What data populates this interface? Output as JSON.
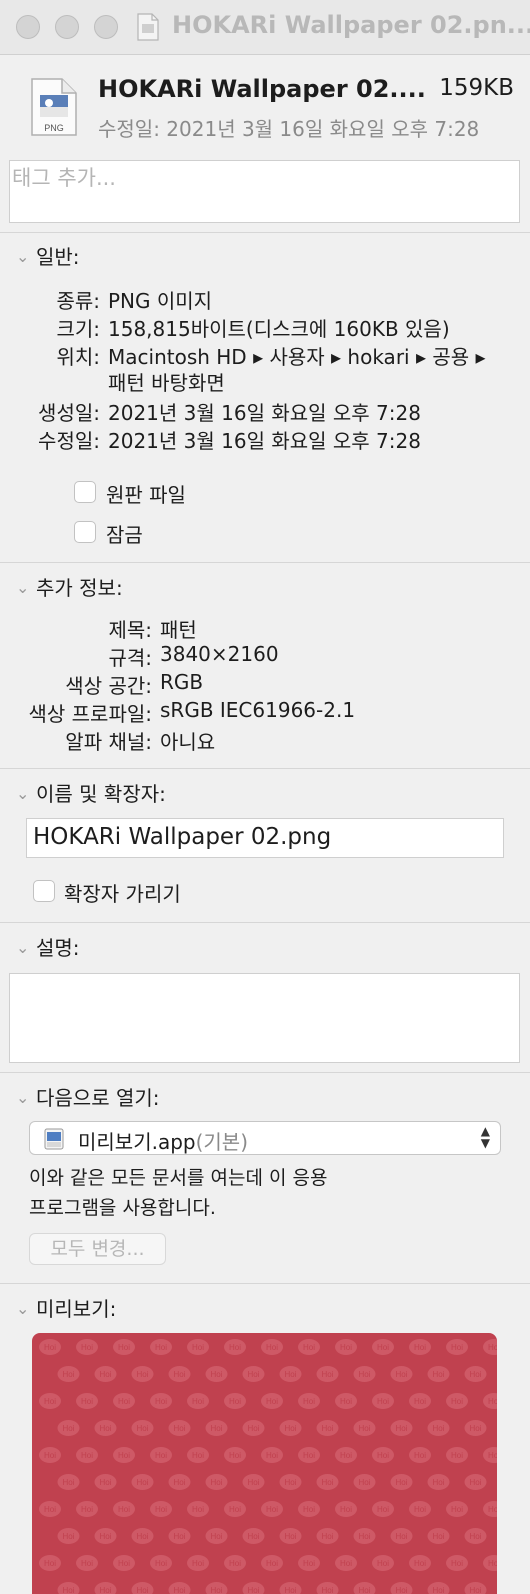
{
  "window": {
    "title": "HOKARi Wallpaper 02.pn..."
  },
  "header": {
    "file_name": "HOKARi Wallpaper 02....",
    "file_size": "159KB",
    "modified": "수정일: 2021년 3월 16일 화요일 오후 7:28",
    "icon_caption": "PNG"
  },
  "tags": {
    "placeholder": "태그 추가..."
  },
  "general": {
    "heading": "일반:",
    "rows": [
      {
        "label": "종류:",
        "value": "PNG 이미지"
      },
      {
        "label": "크기:",
        "value": "158,815바이트(디스크에 160KB 있음)"
      },
      {
        "label": "위치:",
        "value": "Macintosh HD ▸ 사용자 ▸ hokari ▸ 공용 ▸",
        "value2": "패턴 바탕화면"
      },
      {
        "label": "생성일:",
        "value": "2021년 3월 16일 화요일 오후 7:28"
      },
      {
        "label": "수정일:",
        "value": "2021년 3월 16일 화요일 오후 7:28"
      }
    ],
    "stationery_label": "원판 파일",
    "locked_label": "잠금"
  },
  "more_info": {
    "heading": "추가 정보:",
    "rows": [
      {
        "label": "제목:",
        "value": "패턴"
      },
      {
        "label": "규격:",
        "value": "3840×2160"
      },
      {
        "label": "색상 공간:",
        "value": "RGB"
      },
      {
        "label": "색상 프로파일:",
        "value": "sRGB IEC61966-2.1"
      },
      {
        "label": "알파 채널:",
        "value": "아니요"
      }
    ]
  },
  "name_ext": {
    "heading": "이름 및 확장자:",
    "value": "HOKARi Wallpaper 02.png",
    "hide_ext_label": "확장자 가리기"
  },
  "comments": {
    "heading": "설명:"
  },
  "open_with": {
    "heading": "다음으로 열기:",
    "app_name": "미리보기.app",
    "app_default": "(기본)",
    "desc_line1": "이와 같은 모든 문서를 여는데 이 응용",
    "desc_line2": "프로그램을 사용합니다.",
    "change_all_label": "모두 변경..."
  },
  "preview": {
    "heading": "미리보기:",
    "pattern_text": "Hoi",
    "bg_color": "#c0414f",
    "pattern_color": "#ce5966"
  }
}
